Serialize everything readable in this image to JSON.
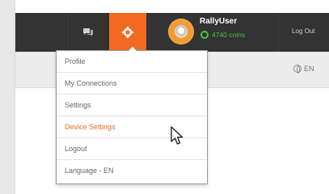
{
  "topbar": {
    "messages_icon": "chat-icon",
    "settings_icon": "gear-icon",
    "accent_color": "#f26a21",
    "user": {
      "name": "RallyUser",
      "coins": "4740 coins",
      "coins_icon": "coin-icon"
    },
    "logout_label": "Log Out"
  },
  "subbar": {
    "language_label": "EN",
    "language_icon": "globe-icon"
  },
  "dropdown": {
    "items": [
      {
        "label": "Profile"
      },
      {
        "label": "My Connections"
      },
      {
        "label": "Settings"
      },
      {
        "label": "Device Settings",
        "active": true
      },
      {
        "label": "Logout"
      },
      {
        "label": "Language - EN"
      }
    ],
    "active_color": "#f06a2a"
  },
  "cursor": {
    "icon": "mouse-pointer-icon"
  }
}
